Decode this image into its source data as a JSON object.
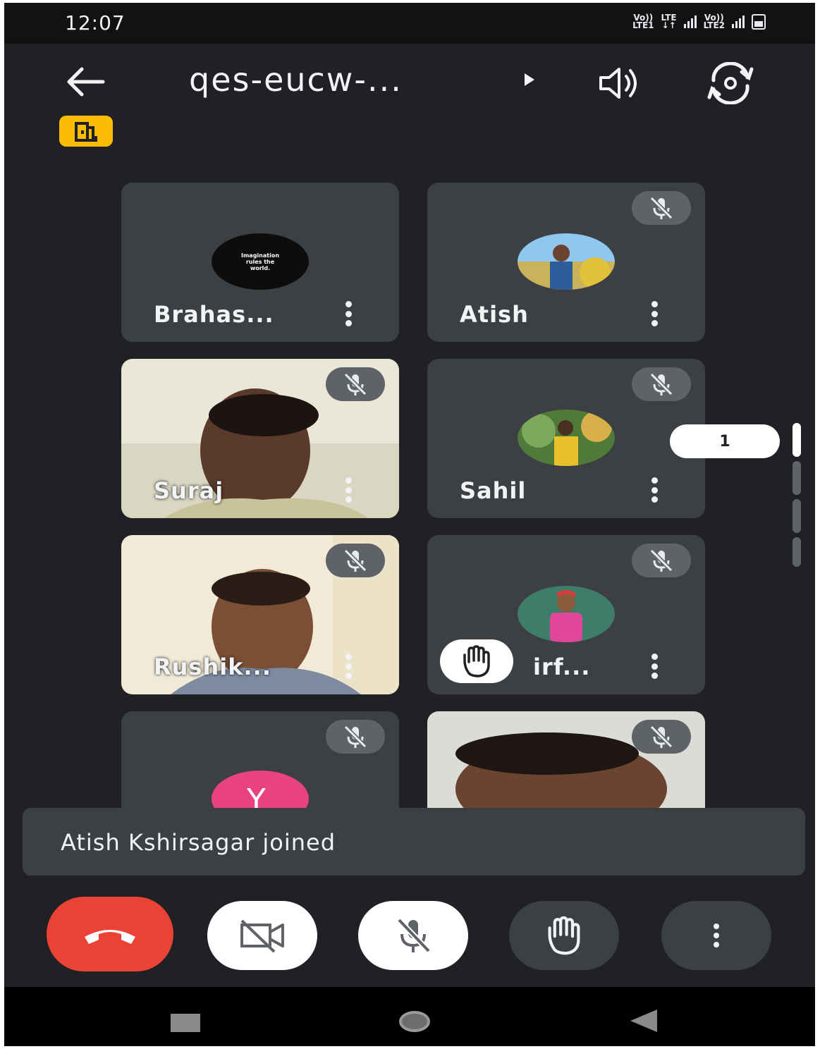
{
  "status_bar": {
    "time": "12:07",
    "sim1_top": "Vo))",
    "sim1_bottom": "LTE1",
    "network_top": "LTE",
    "network_bottom": "↓↑",
    "sim2_top": "Vo))",
    "sim2_bottom": "LTE2"
  },
  "app_bar": {
    "meeting_code": "qes-eucw-...",
    "icons": [
      "back-arrow-icon",
      "expand-triangle-icon",
      "speaker-icon",
      "flip-camera-icon",
      "room-icon"
    ],
    "badge_color": "#fbbc04"
  },
  "participants": [
    {
      "name": "Brahas...",
      "avatar": "logo",
      "avatar_text": "Imagination rules the world.",
      "muted": false,
      "video": false
    },
    {
      "name": "Atish",
      "avatar": "photo",
      "muted": true,
      "video": false
    },
    {
      "name": "Suraj",
      "muted": true,
      "video": true
    },
    {
      "name": "Sahil",
      "avatar": "photo",
      "muted": true,
      "video": false
    },
    {
      "name": "Rushik...",
      "muted": true,
      "video": true
    },
    {
      "name": "irf...",
      "avatar": "photo",
      "muted": true,
      "video": false,
      "hand_raised": true
    },
    {
      "name": "",
      "avatar_letter": "Y",
      "avatar_color": "#e8437e",
      "muted": true,
      "video": false
    },
    {
      "name": "",
      "muted": true,
      "video": true
    }
  ],
  "page_indicator": {
    "label": "1"
  },
  "toast": {
    "text": "Atish Kshirsagar joined"
  },
  "controls": [
    {
      "id": "end-call",
      "icon": "hang-up-icon",
      "color": "#ea4335"
    },
    {
      "id": "camera",
      "icon": "camera-off-icon",
      "state": "off"
    },
    {
      "id": "microphone",
      "icon": "mic-off-icon",
      "state": "off"
    },
    {
      "id": "raise-hand",
      "icon": "hand-icon"
    },
    {
      "id": "more",
      "icon": "more-vert-icon"
    }
  ],
  "colors": {
    "background": "#202124",
    "tile": "#3c4043",
    "accent_red": "#ea4335",
    "badge_yellow": "#fbbc04"
  }
}
